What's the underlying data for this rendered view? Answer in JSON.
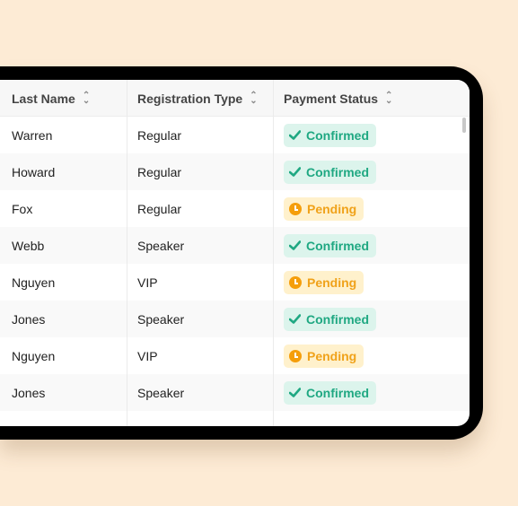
{
  "columns": [
    "Last Name",
    "Registration Type",
    "Payment Status"
  ],
  "rows": [
    {
      "last_name": "Warren",
      "type": "Regular",
      "status": "Confirmed"
    },
    {
      "last_name": "Howard",
      "type": "Regular",
      "status": "Confirmed"
    },
    {
      "last_name": "Fox",
      "type": "Regular",
      "status": "Pending"
    },
    {
      "last_name": "Webb",
      "type": "Speaker",
      "status": "Confirmed"
    },
    {
      "last_name": "Nguyen",
      "type": "VIP",
      "status": "Pending"
    },
    {
      "last_name": "Jones",
      "type": "Speaker",
      "status": "Confirmed"
    },
    {
      "last_name": "Nguyen",
      "type": "VIP",
      "status": "Pending"
    },
    {
      "last_name": "Jones",
      "type": "Speaker",
      "status": "Confirmed"
    }
  ],
  "colors": {
    "confirmed": "#1fa882",
    "pending": "#f0a21a",
    "background": "#fdebd5"
  }
}
